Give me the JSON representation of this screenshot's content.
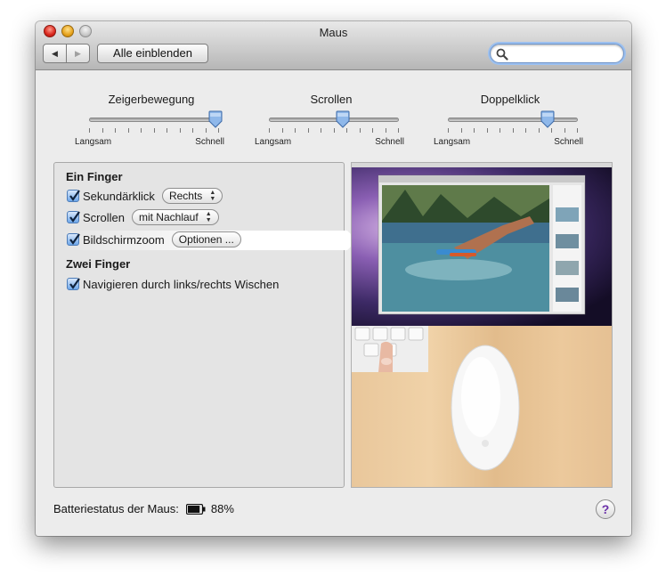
{
  "window": {
    "title": "Maus"
  },
  "toolbar": {
    "back_label": "◀",
    "forward_label": "▶",
    "show_all_label": "Alle einblenden",
    "search_value": "",
    "search_placeholder": ""
  },
  "sliders": [
    {
      "label": "Zeigerbewegung",
      "min_label": "Langsam",
      "max_label": "Schnell",
      "level": 0.97
    },
    {
      "label": "Scrollen",
      "min_label": "Langsam",
      "max_label": "Schnell",
      "level": 0.57
    },
    {
      "label": "Doppelklick",
      "min_label": "Langsam",
      "max_label": "Schnell",
      "level": 0.77
    }
  ],
  "one_finger": {
    "heading": "Ein Finger",
    "secondary_click": {
      "label": "Sekundärklick",
      "checked": true,
      "value": "Rechts"
    },
    "scrolling": {
      "label": "Scrollen",
      "checked": true,
      "value": "mit Nachlauf"
    },
    "screen_zoom": {
      "label": "Bildschirmzoom",
      "checked": true,
      "button": "Optionen ..."
    }
  },
  "two_fingers": {
    "heading": "Zwei Finger",
    "swipe_navigation": {
      "label": "Navigieren durch links/rechts Wischen",
      "checked": true
    }
  },
  "footer": {
    "battery_label": "Batteriestatus der Maus:",
    "battery_value": "88%",
    "help_label": "?"
  },
  "colors": {
    "accent": "#5b9be6",
    "help": "#6a2ea8"
  }
}
